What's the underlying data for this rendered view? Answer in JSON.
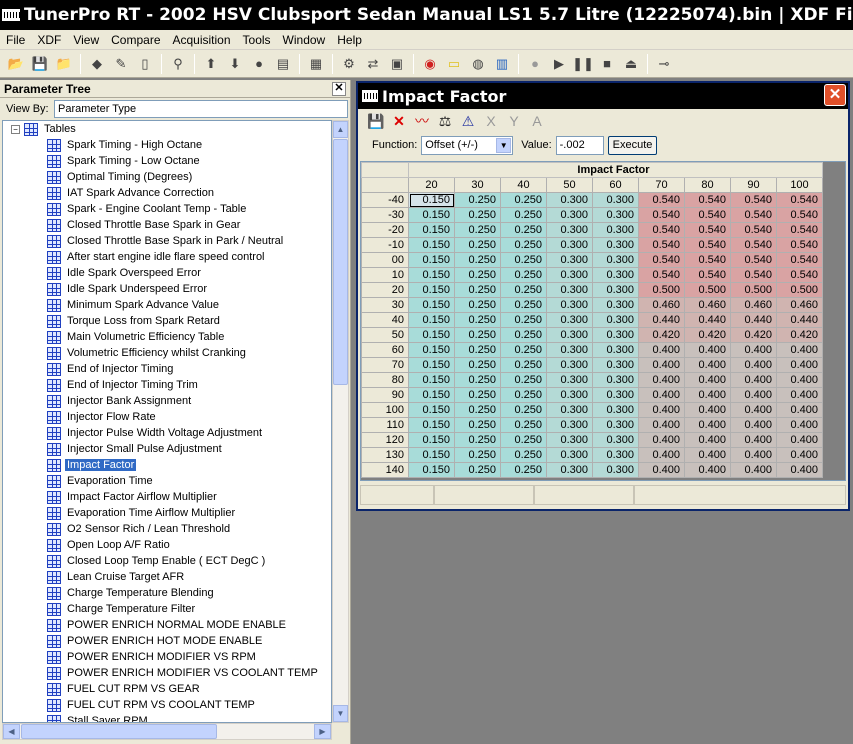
{
  "app": {
    "title": "TunerPro RT - 2002 HSV Clubsport Sedan Manual LS1 5.7 Litre (12225074).bin | XDF File - D:",
    "menu": [
      "File",
      "XDF",
      "View",
      "Compare",
      "Acquisition",
      "Tools",
      "Window",
      "Help"
    ]
  },
  "toolbar_icons": [
    "open-folder-icon",
    "save-icon",
    "open-bin-icon",
    "sep",
    "xdf-icon",
    "edit-icon",
    "new-icon",
    "sep",
    "probe-icon",
    "sep",
    "up-arrow-icon",
    "down-arrow-icon",
    "record-icon",
    "stack-icon",
    "sep",
    "chip-icon",
    "sep",
    "settings-icon",
    "swap-icon",
    "emulator-icon",
    "sep",
    "gauge-icon",
    "notepad-icon",
    "globe-icon",
    "chart-icon",
    "sep",
    "stop-circle-icon",
    "play-icon",
    "pause-icon",
    "stop-icon",
    "eject-icon",
    "sep",
    "slider-icon"
  ],
  "tree": {
    "header": "Parameter Tree",
    "close_label": "✕",
    "view_by_label": "View By:",
    "view_by_value": "Parameter Type",
    "root_label": "Tables",
    "expander": "−",
    "selected_index": 20,
    "items": [
      "Spark Timing - High Octane",
      "Spark Timing - Low Octane",
      "Optimal Timing (Degrees)",
      "IAT Spark Advance Correction",
      "Spark - Engine Coolant Temp - Table",
      "Closed Throttle Base Spark in Gear",
      "Closed Throttle Base Spark in Park / Neutral",
      "After start engine idle flare speed control",
      "Idle Spark Overspeed Error",
      "Idle Spark Underspeed Error",
      "Minimum Spark Advance Value",
      "Torque Loss from Spark Retard",
      "Main Volumetric Efficiency Table",
      "Volumetric Efficiency whilst Cranking",
      "End of Injector Timing",
      "End of Injector Timing Trim",
      "Injector Bank Assignment",
      "Injector Flow Rate",
      "Injector Pulse Width Voltage Adjustment",
      "Injector Small Pulse Adjustment",
      "Impact Factor",
      "Evaporation Time",
      "Impact Factor Airflow Multiplier",
      "Evaporation Time Airflow Multiplier",
      "O2 Sensor Rich /  Lean Threshold",
      "Open Loop A/F Ratio",
      "Closed Loop Temp Enable ( ECT DegC )",
      "Lean Cruise Target AFR",
      "Charge Temperature Blending",
      "Charge Temperature Filter",
      "POWER ENRICH NORMAL MODE ENABLE",
      "POWER ENRICH HOT MODE ENABLE",
      "POWER ENRICH MODIFIER VS RPM",
      "POWER ENRICH MODIFIER VS COOLANT TEMP",
      "FUEL CUT RPM VS GEAR",
      "FUEL CUT RPM VS COOLANT TEMP",
      "Stall Saver RPM"
    ]
  },
  "window": {
    "title": "Impact Factor",
    "close_label": "✕",
    "toolbar_icons": [
      "save-icon",
      "delete-icon",
      "graph-icon",
      "balance-icon",
      "warning-icon",
      "text-x-icon",
      "text-y-icon",
      "text-a-icon"
    ],
    "function_label": "Function:",
    "function_value": "Offset (+/-)",
    "value_label": "Value:",
    "value_value": "-.002",
    "execute_label": "Execute",
    "table_caption": "Impact Factor",
    "columns": [
      "20",
      "30",
      "40",
      "50",
      "60",
      "70",
      "80",
      "90",
      "100"
    ],
    "rows": [
      "-40",
      "-30",
      "-20",
      "-10",
      "00",
      "10",
      "20",
      "30",
      "40",
      "50",
      "60",
      "70",
      "80",
      "90",
      "100",
      "110",
      "120",
      "130",
      "140"
    ],
    "values": [
      [
        "0.150",
        "0.250",
        "0.250",
        "0.300",
        "0.300",
        "0.540",
        "0.540",
        "0.540",
        "0.540"
      ],
      [
        "0.150",
        "0.250",
        "0.250",
        "0.300",
        "0.300",
        "0.540",
        "0.540",
        "0.540",
        "0.540"
      ],
      [
        "0.150",
        "0.250",
        "0.250",
        "0.300",
        "0.300",
        "0.540",
        "0.540",
        "0.540",
        "0.540"
      ],
      [
        "0.150",
        "0.250",
        "0.250",
        "0.300",
        "0.300",
        "0.540",
        "0.540",
        "0.540",
        "0.540"
      ],
      [
        "0.150",
        "0.250",
        "0.250",
        "0.300",
        "0.300",
        "0.540",
        "0.540",
        "0.540",
        "0.540"
      ],
      [
        "0.150",
        "0.250",
        "0.250",
        "0.300",
        "0.300",
        "0.540",
        "0.540",
        "0.540",
        "0.540"
      ],
      [
        "0.150",
        "0.250",
        "0.250",
        "0.300",
        "0.300",
        "0.500",
        "0.500",
        "0.500",
        "0.500"
      ],
      [
        "0.150",
        "0.250",
        "0.250",
        "0.300",
        "0.300",
        "0.460",
        "0.460",
        "0.460",
        "0.460"
      ],
      [
        "0.150",
        "0.250",
        "0.250",
        "0.300",
        "0.300",
        "0.440",
        "0.440",
        "0.440",
        "0.440"
      ],
      [
        "0.150",
        "0.250",
        "0.250",
        "0.300",
        "0.300",
        "0.420",
        "0.420",
        "0.420",
        "0.420"
      ],
      [
        "0.150",
        "0.250",
        "0.250",
        "0.300",
        "0.300",
        "0.400",
        "0.400",
        "0.400",
        "0.400"
      ],
      [
        "0.150",
        "0.250",
        "0.250",
        "0.300",
        "0.300",
        "0.400",
        "0.400",
        "0.400",
        "0.400"
      ],
      [
        "0.150",
        "0.250",
        "0.250",
        "0.300",
        "0.300",
        "0.400",
        "0.400",
        "0.400",
        "0.400"
      ],
      [
        "0.150",
        "0.250",
        "0.250",
        "0.300",
        "0.300",
        "0.400",
        "0.400",
        "0.400",
        "0.400"
      ],
      [
        "0.150",
        "0.250",
        "0.250",
        "0.300",
        "0.300",
        "0.400",
        "0.400",
        "0.400",
        "0.400"
      ],
      [
        "0.150",
        "0.250",
        "0.250",
        "0.300",
        "0.300",
        "0.400",
        "0.400",
        "0.400",
        "0.400"
      ],
      [
        "0.150",
        "0.250",
        "0.250",
        "0.300",
        "0.300",
        "0.400",
        "0.400",
        "0.400",
        "0.400"
      ],
      [
        "0.150",
        "0.250",
        "0.250",
        "0.300",
        "0.300",
        "0.400",
        "0.400",
        "0.400",
        "0.400"
      ],
      [
        "0.150",
        "0.250",
        "0.250",
        "0.300",
        "0.300",
        "0.400",
        "0.400",
        "0.400",
        "0.400"
      ]
    ],
    "cell_colors": {
      "low": "#a8dcd9",
      "mid": "#b4dad6",
      "high": "#d9a3a3",
      "neutral": "#c8c0bc",
      "selected": "#d6e4ea"
    }
  }
}
